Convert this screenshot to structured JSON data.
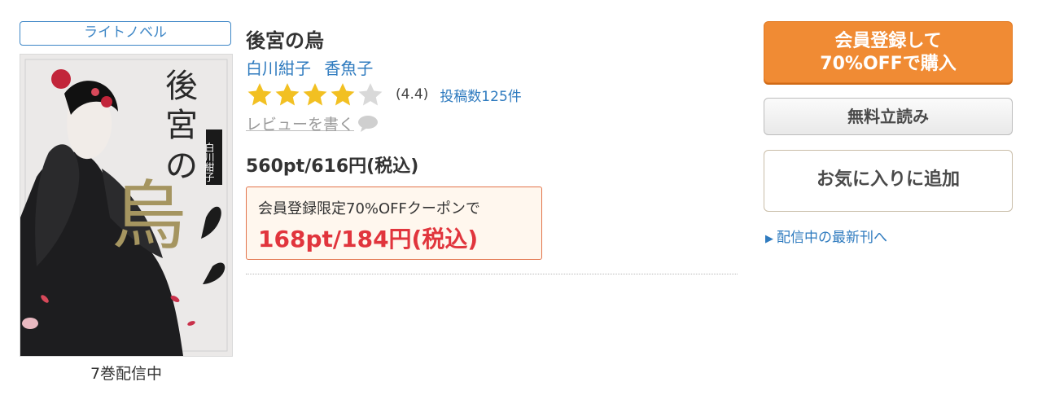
{
  "genre": "ライトノベル",
  "cover": {
    "title_vertical": [
      "後",
      "宮",
      "の"
    ],
    "title_large": "烏",
    "author_vertical": "白川紺子"
  },
  "volumes": "7巻配信中",
  "title": "後宮の烏",
  "authors": [
    "白川紺子",
    "香魚子"
  ],
  "rating": {
    "stars_filled": 4,
    "stars_total": 5,
    "value": "(4.4)",
    "review_count": "投稿数125件"
  },
  "write_review": "レビューを書く",
  "price": "560pt/616円(税込)",
  "coupon": {
    "label": "会員登録限定70%OFFクーポンで",
    "price": "168pt/184円(税込)"
  },
  "buttons": {
    "buy_line1": "会員登録して",
    "buy_line2": "70%OFFで購入",
    "preview": "無料立読み",
    "favorite": "お気に入りに追加"
  },
  "latest_link": "配信中の最新刊へ",
  "colors": {
    "accent_blue": "#2f7bbf",
    "buy_orange": "#f08b34",
    "coupon_red": "#e1353d",
    "star_gold": "#f2c022"
  }
}
